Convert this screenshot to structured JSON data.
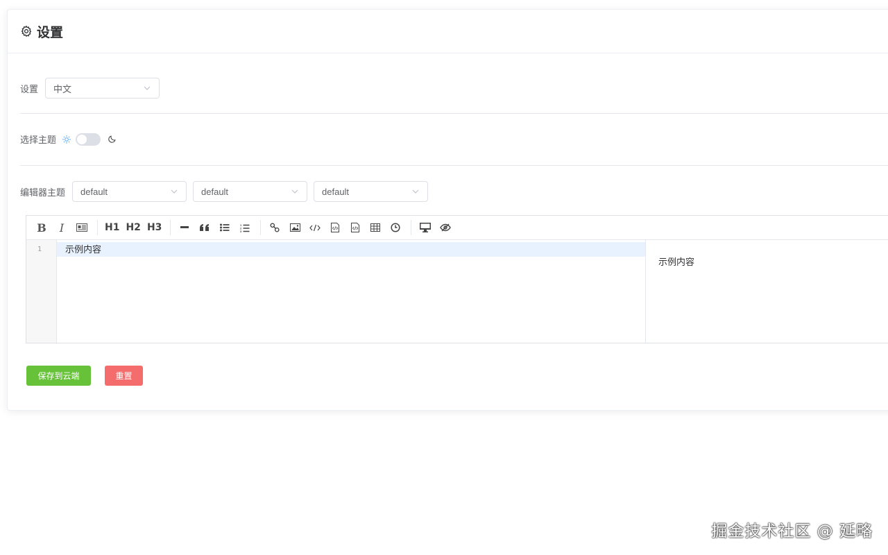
{
  "header": {
    "title": "设置",
    "icon": "gear-icon"
  },
  "language": {
    "label": "设置",
    "select_value": "中文"
  },
  "theme": {
    "label": "选择主题",
    "light_icon": "sun-icon",
    "dark_icon": "moon-icon",
    "accent": "#409eff"
  },
  "editor_theme": {
    "label": "编辑器主题",
    "selects": [
      "default",
      "default",
      "default"
    ]
  },
  "editor": {
    "toolbar": {
      "h1": "H1",
      "h2": "H2",
      "h3": "H3"
    },
    "line_number": "1",
    "code_text": "示例内容",
    "preview_text": "示例内容"
  },
  "actions": {
    "save_label": "保存到云端",
    "save_color": "#67c23a",
    "reset_label": "重置",
    "reset_color": "#f56c6c"
  },
  "watermark": "掘金技术社区 @ 延略"
}
